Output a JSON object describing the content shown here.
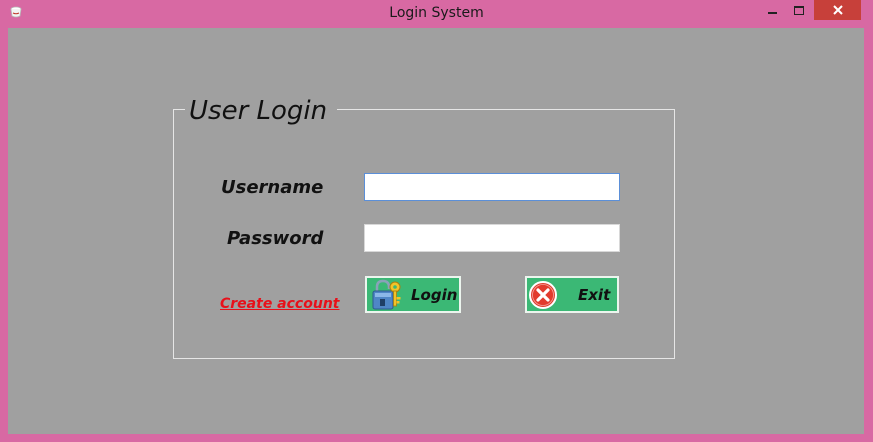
{
  "window": {
    "title": "Login System",
    "app_icon": "cup-icon",
    "controls": {
      "minimize_icon": "minimize-icon",
      "maximize_icon": "maximize-icon",
      "close_icon": "close-icon"
    },
    "close_color": "#c7403a",
    "frame_color": "#d869a3"
  },
  "form": {
    "group_title": "User Login",
    "username_label": "Username",
    "password_label": "Password",
    "username_value": "",
    "password_value": "",
    "create_account_link": "Create account",
    "login_button": "Login",
    "login_icon": "lock-key-icon",
    "exit_button": "Exit",
    "exit_icon": "close-circle-icon",
    "button_color": "#3bb875",
    "link_color": "#e8101a",
    "background_color": "#a0a0a0"
  }
}
